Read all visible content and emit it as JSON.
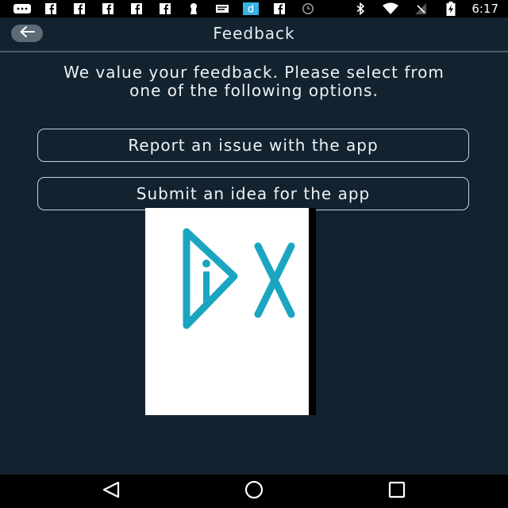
{
  "status_bar": {
    "time": "6:17",
    "left_icons": [
      "messages-icon",
      "facebook-icon",
      "facebook-icon",
      "facebook-icon",
      "facebook-icon",
      "facebook-icon",
      "keyhole-icon",
      "mail-icon",
      "dictionary-icon",
      "facebook-icon",
      "alarm-icon"
    ],
    "right_icons": [
      "bluetooth-icon",
      "wifi-icon",
      "no-signal-icon",
      "battery-charging-icon"
    ]
  },
  "app_bar": {
    "title": "Feedback"
  },
  "intro": {
    "line1": "We value your feedback. Please select from",
    "line2": "one of the following options."
  },
  "options": [
    {
      "label": "Report an issue with the app"
    },
    {
      "label": "Submit an idea for the app"
    }
  ],
  "logo": {
    "text": "DX",
    "color": "#1aa6c0"
  },
  "colors": {
    "background": "#12222f",
    "status_bar": "#000000",
    "nav_bar": "#000000",
    "accent": "#1aa6c0"
  },
  "nav_bar": {
    "buttons": [
      "back",
      "home",
      "recents"
    ]
  }
}
